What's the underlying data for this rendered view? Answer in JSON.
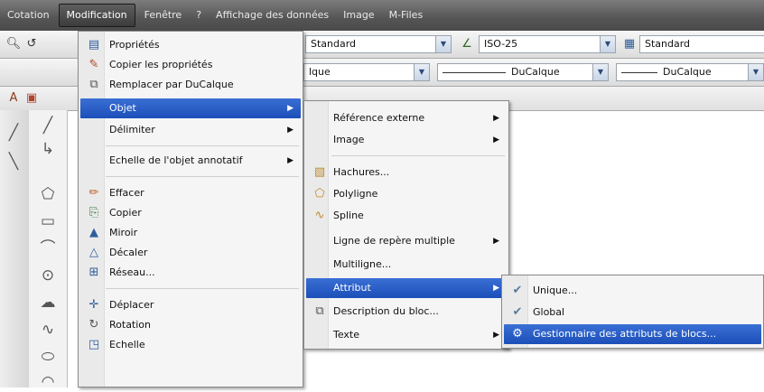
{
  "menubar": [
    {
      "label": "Cotation",
      "active": false
    },
    {
      "label": "Modification",
      "active": true
    },
    {
      "label": "Fenêtre",
      "active": false
    },
    {
      "label": "?",
      "active": false
    },
    {
      "label": "Affichage des données",
      "active": false
    },
    {
      "label": "Image",
      "active": false
    },
    {
      "label": "M-Files",
      "active": false
    }
  ],
  "toolbar": {
    "style1": "Standard",
    "dimstyle": "ISO-25",
    "style2": "Standard",
    "layer_partial": "lque",
    "linetype": "DuCalque",
    "lineweight": "DuCalque"
  },
  "menu_modification": {
    "items": [
      {
        "label": "Propriétés",
        "icon": "properties-icon"
      },
      {
        "label": "Copier les propriétés",
        "icon": "match-properties-icon"
      },
      {
        "label": "Remplacer par DuCalque",
        "icon": "bylayer-icon"
      },
      {
        "label": "Objet",
        "submenu": true,
        "highlighted": true
      },
      {
        "label": "Délimiter",
        "submenu": true
      },
      {
        "label": "Echelle de l'objet annotatif",
        "submenu": true
      },
      {
        "label": "Effacer",
        "icon": "eraser-icon"
      },
      {
        "label": "Copier",
        "icon": "copy-icon"
      },
      {
        "label": "Miroir",
        "icon": "mirror-icon"
      },
      {
        "label": "Décaler",
        "icon": "offset-icon"
      },
      {
        "label": "Réseau...",
        "icon": "array-icon"
      },
      {
        "label": "Déplacer",
        "icon": "move-icon"
      },
      {
        "label": "Rotation",
        "icon": "rotate-icon"
      },
      {
        "label": "Echelle",
        "icon": "scale-icon"
      }
    ]
  },
  "menu_objet": {
    "items": [
      {
        "label": "Référence externe",
        "submenu": true
      },
      {
        "label": "Image",
        "submenu": true
      },
      {
        "label": "Hachures...",
        "icon": "hatch-icon"
      },
      {
        "label": "Polyligne",
        "icon": "polyline-icon"
      },
      {
        "label": "Spline",
        "icon": "spline-icon"
      },
      {
        "label": "Ligne de repère multiple",
        "submenu": true
      },
      {
        "label": "Multiligne..."
      },
      {
        "label": "Attribut",
        "submenu": true,
        "highlighted": true
      },
      {
        "label": "Description du bloc...",
        "icon": "block-description-icon"
      },
      {
        "label": "Texte",
        "submenu": true
      }
    ]
  },
  "menu_attribut": {
    "items": [
      {
        "label": "Unique...",
        "icon": "attribute-single-icon"
      },
      {
        "label": "Global",
        "icon": "attribute-global-icon"
      },
      {
        "label": "Gestionnaire des attributs de blocs...",
        "icon": "block-attribute-manager-icon",
        "highlighted": true
      }
    ]
  },
  "colors": {
    "highlight": "#1c4fb9",
    "menubar": "#555555"
  }
}
